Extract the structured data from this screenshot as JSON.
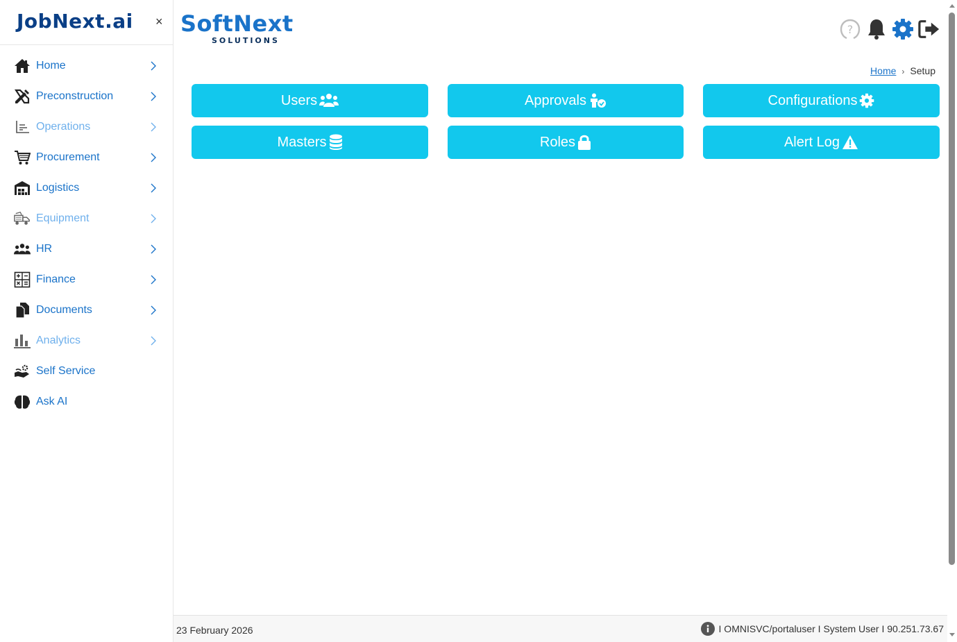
{
  "sidebar": {
    "brand_main": "JobNext",
    "brand_suffix": ".ai",
    "close_label": "×",
    "items": [
      {
        "label": "Home",
        "icon": "home-icon"
      },
      {
        "label": "Preconstruction",
        "icon": "ruler-pencil-icon"
      },
      {
        "label": "Operations",
        "icon": "chart-axis-icon"
      },
      {
        "label": "Procurement",
        "icon": "cart-icon"
      },
      {
        "label": "Logistics",
        "icon": "warehouse-icon"
      },
      {
        "label": "Equipment",
        "icon": "truck-icon"
      },
      {
        "label": "HR",
        "icon": "people-icon"
      },
      {
        "label": "Finance",
        "icon": "calculator-icon"
      },
      {
        "label": "Documents",
        "icon": "documents-icon"
      },
      {
        "label": "Analytics",
        "icon": "bar-chart-icon"
      },
      {
        "label": "Self Service",
        "icon": "hand-gear-icon"
      },
      {
        "label": "Ask AI",
        "icon": "brain-icon"
      }
    ]
  },
  "header": {
    "logo_main": "SoftNext",
    "logo_sub": "SOLUTIONS"
  },
  "breadcrumb": {
    "home": "Home",
    "separator": "›",
    "current": "Setup"
  },
  "tiles": [
    {
      "label": "Users",
      "icon": "users-icon"
    },
    {
      "label": "Approvals",
      "icon": "approval-person-icon"
    },
    {
      "label": "Configurations",
      "icon": "gear-icon"
    },
    {
      "label": "Masters",
      "icon": "database-icon"
    },
    {
      "label": "Roles",
      "icon": "lock-icon"
    },
    {
      "label": "Alert Log",
      "icon": "warning-icon"
    }
  ],
  "footer": {
    "date": "23 February 2026",
    "session": "I OMNISVC/portaluser I System User I 90.251.73.67"
  },
  "colors": {
    "tile_bg": "#12c8ed",
    "nav_text": "#1a73c9",
    "nav_text_dim": "#6fb0ec",
    "brand": "#0a3f86"
  }
}
